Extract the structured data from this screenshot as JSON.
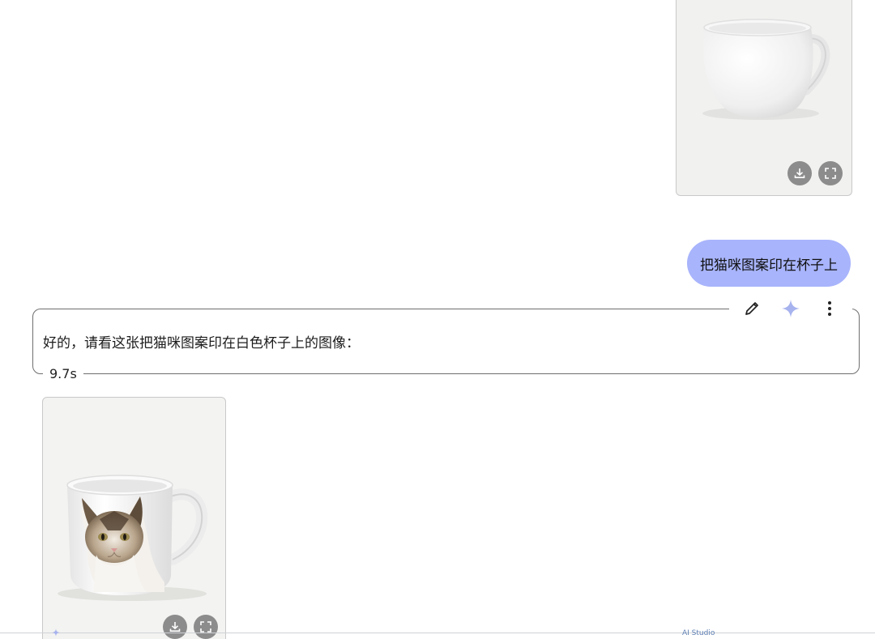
{
  "user_message": {
    "text": "把猫咪图案印在杯子上"
  },
  "model_response": {
    "text": "好的，请看这张把猫咪图案印在白色杯子上的图像：",
    "elapsed": "9.7s"
  },
  "toolbar": {
    "icons": [
      "edit-icon",
      "sparkle-icon",
      "more-vert-icon"
    ]
  },
  "image_cards": [
    {
      "content": "white mug",
      "icons": [
        "download-icon",
        "fullscreen-icon"
      ]
    },
    {
      "content": "white mug with cat print",
      "icons": [
        "download-icon",
        "fullscreen-icon"
      ]
    }
  ],
  "footer": {
    "label": "AI Studio"
  },
  "colors": {
    "user_bubble": "#a8b4fb",
    "sparkle": "#a7b3ee",
    "card_bg": "#f1f1ef",
    "icon_button": "#8c8c8c"
  }
}
